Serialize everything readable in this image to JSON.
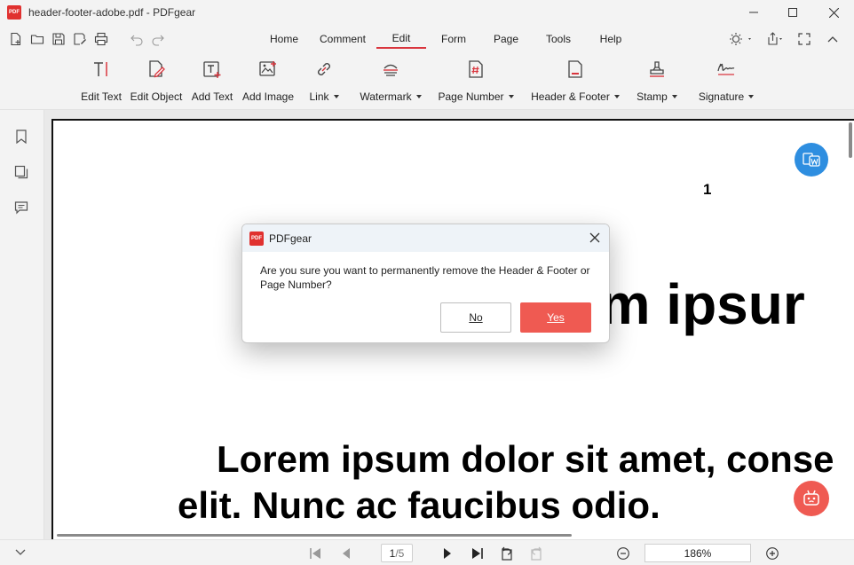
{
  "window": {
    "title": "header-footer-adobe.pdf - PDFgear",
    "logo_text": "PDF"
  },
  "menu": {
    "tabs": [
      {
        "label": "Home"
      },
      {
        "label": "Comment"
      },
      {
        "label": "Edit",
        "active": true
      },
      {
        "label": "Form"
      },
      {
        "label": "Page"
      },
      {
        "label": "Tools"
      },
      {
        "label": "Help"
      }
    ]
  },
  "ribbon": {
    "tools": [
      {
        "label": "Edit Text",
        "icon": "edit-text-icon"
      },
      {
        "label": "Edit Object",
        "icon": "edit-object-icon"
      },
      {
        "label": "Add Text",
        "icon": "add-text-icon"
      },
      {
        "label": "Add Image",
        "icon": "add-image-icon"
      },
      {
        "label": "Link",
        "icon": "link-icon",
        "dropdown": true
      },
      {
        "label": "Watermark",
        "icon": "watermark-icon",
        "dropdown": true
      },
      {
        "label": "Page Number",
        "icon": "page-number-icon",
        "dropdown": true
      },
      {
        "label": "Header & Footer",
        "icon": "header-footer-icon",
        "dropdown": true
      },
      {
        "label": "Stamp",
        "icon": "stamp-icon",
        "dropdown": true
      },
      {
        "label": "Signature",
        "icon": "signature-icon",
        "dropdown": true
      }
    ]
  },
  "document": {
    "page_number": "1",
    "heading_fragment": "em ipsur",
    "paragraph_line1": "Lorem ipsum dolor sit amet, conse",
    "paragraph_line2": "elit. Nunc ac faucibus odio."
  },
  "statusbar": {
    "current_page": "1",
    "total_pages": "/5",
    "zoom": "186%"
  },
  "dialog": {
    "title": "PDFgear",
    "message": "Are you sure you want to permanently remove the Header & Footer or Page Number?",
    "no_label": "No",
    "yes_label": "Yes"
  },
  "colors": {
    "accent_red": "#d9363e",
    "yes_button": "#ef5a52",
    "convert_fab": "#2e8ee0",
    "ai_fab": "#ef5a52"
  }
}
